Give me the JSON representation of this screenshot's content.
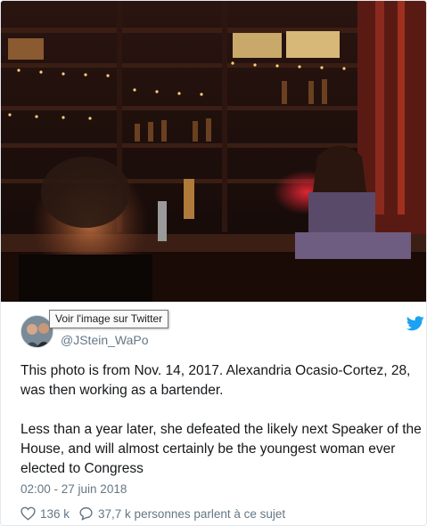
{
  "tweet": {
    "photo": {
      "description_icon": "bar-photo-image"
    },
    "tooltip": "Voir l'image sur Twitter",
    "handle": "@JStein_WaPo",
    "paragraphs": [
      "This photo is from Nov. 14, 2017. Alexandria Ocasio-Cortez, 28, was then working as a bartender.",
      "Less than a year later, she defeated the likely next Speaker of the House, and will almost certainly be the youngest woman ever elected to Congress"
    ],
    "timestamp": "02:00 - 27 juin 2018",
    "likes": "136 k",
    "conversation": "37,7 k personnes parlent à ce sujet",
    "icons": {
      "bird": "twitter-bird-icon",
      "like": "heart-icon",
      "reply": "speech-bubble-icon"
    },
    "colors": {
      "brand": "#1da1f2",
      "muted": "#657786",
      "text": "#14171a"
    }
  }
}
